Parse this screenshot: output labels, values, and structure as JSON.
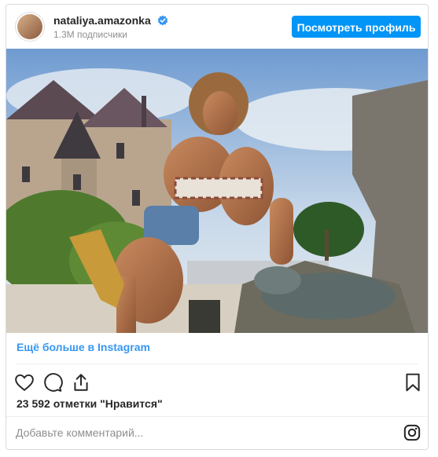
{
  "header": {
    "username": "nataliya.amazonka",
    "followers": "1.3M подписчики",
    "view_profile_label": "Посмотреть профиль"
  },
  "post": {
    "more_link": "Ещё больше в Instagram",
    "likes": "23 592 отметки \"Нравится\"",
    "comment_placeholder": "Добавьте комментарий..."
  },
  "icons": {
    "verified": "verified-badge-icon",
    "like": "heart-icon",
    "comment": "comment-icon",
    "share": "share-icon",
    "save": "bookmark-icon",
    "instagram": "instagram-logo-icon"
  },
  "colors": {
    "accent": "#0095f6",
    "link": "#3897f0",
    "text": "#262626",
    "muted": "#8e8e8e"
  }
}
